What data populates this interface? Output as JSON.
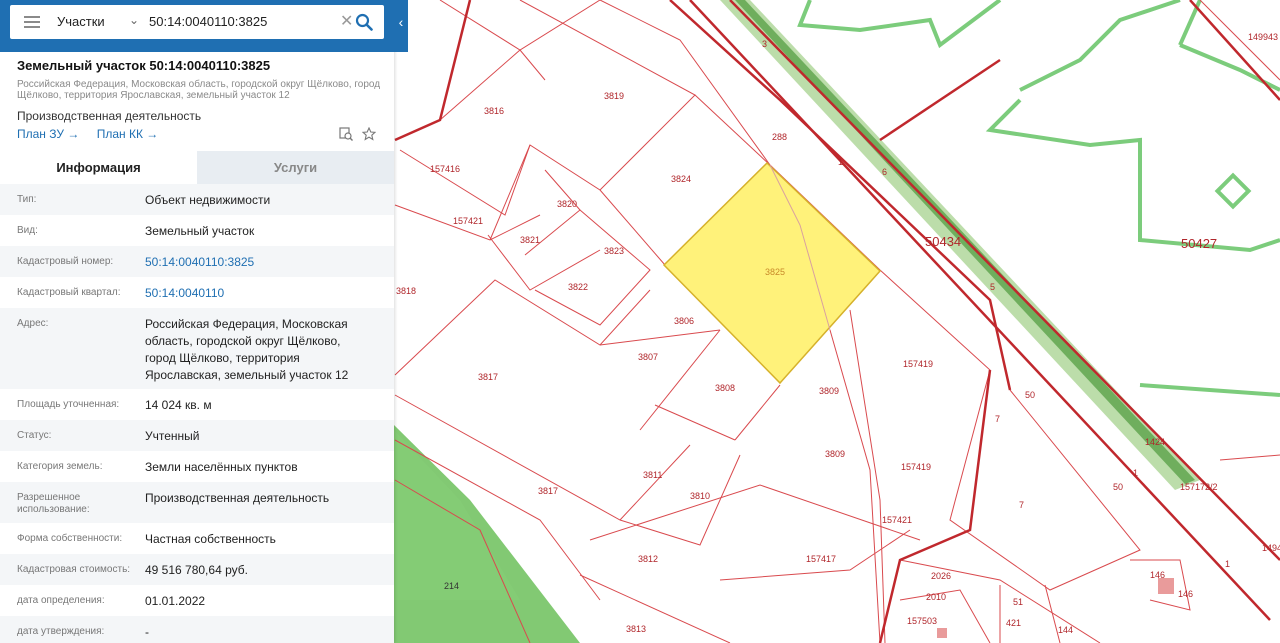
{
  "search": {
    "layer": "Участки",
    "query": "50:14:0040110:3825",
    "clear_glyph": "✕"
  },
  "parcel": {
    "title": "Земельный участок 50:14:0040110:3825",
    "address": "Российская Федерация, Московская область, городской округ Щёлково, город Щёлково, территория Ярославская, земельный участок 12",
    "use": "Производственная деятельность",
    "link_plan_zu": "План ЗУ →",
    "link_plan_kk": "План КК →"
  },
  "tabs": {
    "info": "Информация",
    "services": "Услуги"
  },
  "info_rows": [
    {
      "k": "Тип:",
      "v": "Объект недвижимости"
    },
    {
      "k": "Вид:",
      "v": "Земельный участок"
    },
    {
      "k": "Кадастровый номер:",
      "v": "50:14:0040110:3825",
      "link": true
    },
    {
      "k": "Кадастровый квартал:",
      "v": "50:14:0040110",
      "link": true
    },
    {
      "k": "Адрес:",
      "v": "Российская Федерация, Московская область, городской округ Щёлково, город Щёлково, территория Ярославская, земельный участок 12"
    },
    {
      "k": "Площадь уточненная:",
      "v": "14 024 кв. м"
    },
    {
      "k": "Статус:",
      "v": "Учтенный"
    },
    {
      "k": "Категория земель:",
      "v": "Земли населённых пунктов"
    },
    {
      "k": "Разрешенное использование:",
      "v": "Производственная деятельность"
    },
    {
      "k": "Форма собственности:",
      "v": "Частная собственность"
    },
    {
      "k": "Кадастровая стоимость:",
      "v": "49 516 780,64 руб."
    },
    {
      "k": "дата определения:",
      "v": "01.01.2022"
    },
    {
      "k": "дата утверждения:",
      "v": "-"
    }
  ],
  "map_labels": {
    "l3816": "3816",
    "l3819": "3819",
    "l157416": "157416",
    "l288": "288",
    "l3824": "3824",
    "l157421a": "157421",
    "l3820": "3820",
    "l3821": "3821",
    "l3823": "3823",
    "l3822": "3822",
    "l3825": "3825",
    "l3818": "3818",
    "l3806": "3806",
    "l3807": "3807",
    "l3817a": "3817",
    "l3808": "3808",
    "l3809a": "3809",
    "l157419a": "157419",
    "l3809b": "3809",
    "l157419b": "157419",
    "l3811": "3811",
    "l3810": "3810",
    "l3817b": "3817",
    "l157421b": "157421",
    "l3812": "3812",
    "l157417": "157417",
    "l2026": "2026",
    "l2010": "2010",
    "l157503": "157503",
    "l3813": "3813",
    "l214": "214",
    "l51": "51",
    "l144": "144",
    "l421": "421",
    "l50434": "50434",
    "l50427": "50427",
    "l7a": "7",
    "l7b": "7",
    "l1a": "1",
    "l1b": "1",
    "l1c": "1",
    "l50a": "50",
    "l50b": "50",
    "l3": "3",
    "l6": "6",
    "l5": "5",
    "l146a": "146",
    "l146b": "146",
    "l157172": "157172/2",
    "l1494": "1494",
    "l49943": "149943",
    "l124": "1424"
  },
  "colors": {
    "accent": "#1f6fb2",
    "parcel_border": "#c0282d",
    "selected_fill": "#fff27a",
    "green_line": "#7ccc7c",
    "green_area": "#6cbf5a"
  }
}
